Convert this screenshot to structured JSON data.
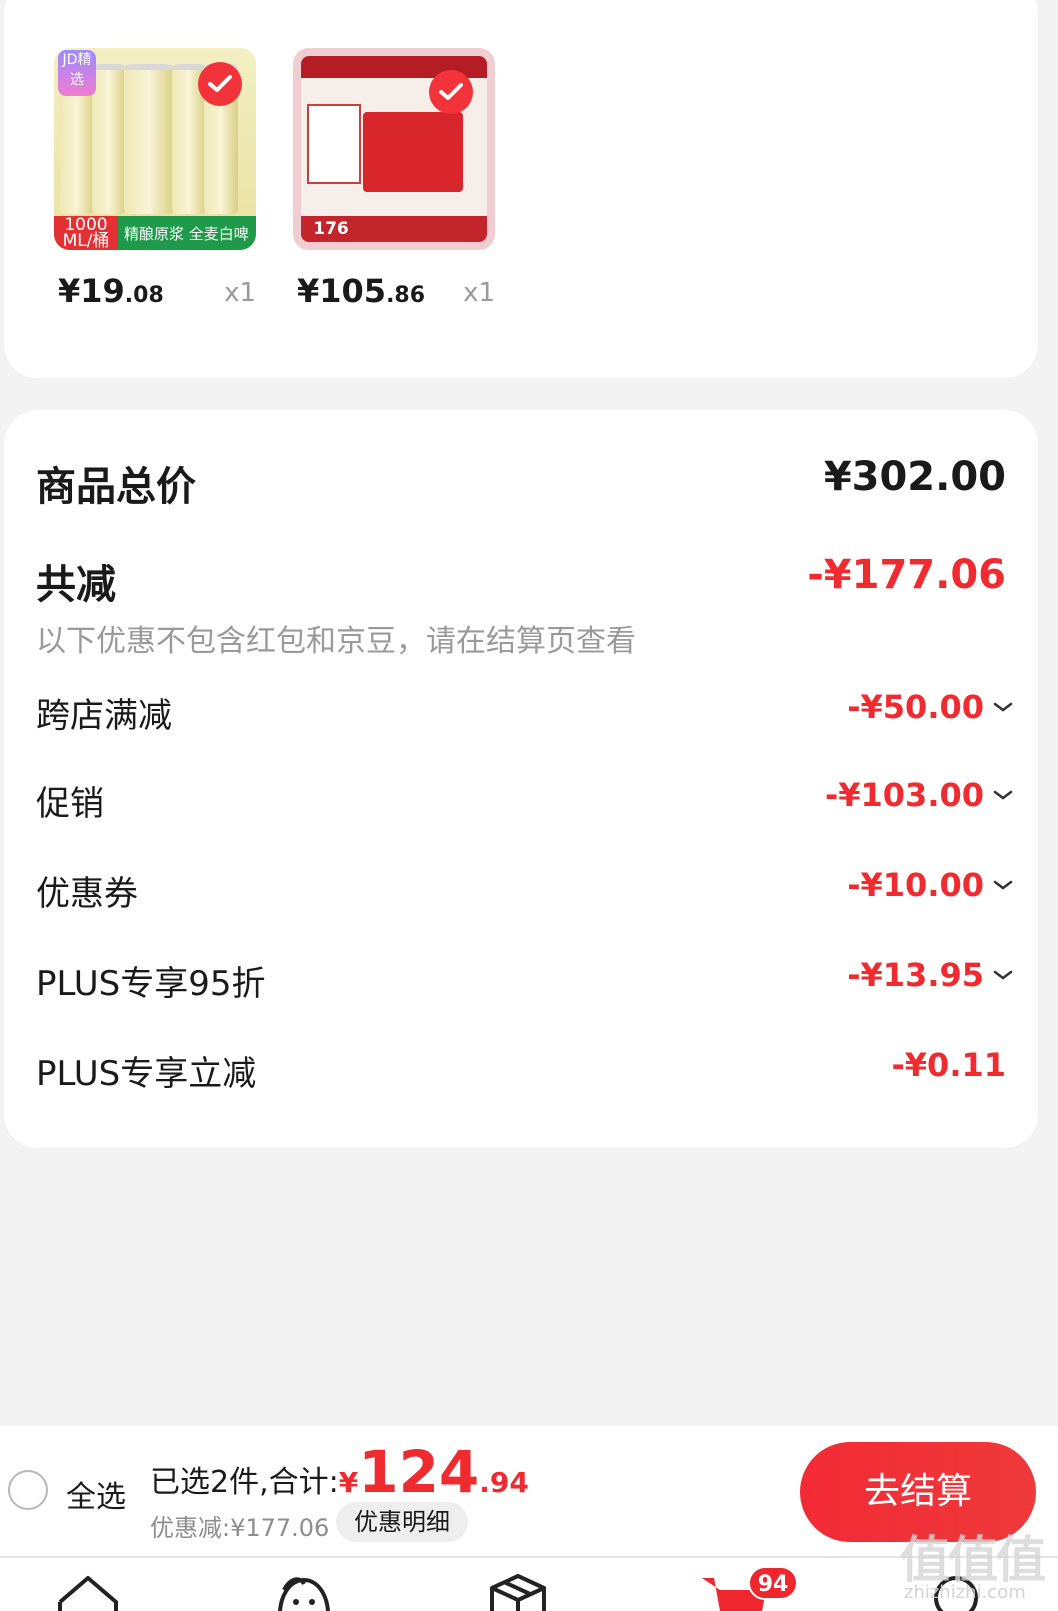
{
  "products": [
    {
      "image_label": "beer-product-image",
      "tag": "JD精选",
      "volume": "1000 ML/桶",
      "banner": "精酿原浆 全麦白啤",
      "price_int": "¥19",
      "price_dec": ".08",
      "qty": "x1"
    },
    {
      "image_label": "liquor-gift-box-image",
      "banner_price": "176",
      "price_int": "¥105",
      "price_dec": ".86",
      "qty": "x1"
    }
  ],
  "summary": {
    "total_label": "商品总价",
    "total_value": "¥302.00",
    "reduce_label": "共减",
    "reduce_value": "-¥177.06",
    "note": "以下优惠不包含红包和京豆，请在结算页查看",
    "items": [
      {
        "label": "跨店满减",
        "value": "-¥50.00",
        "expandable": true
      },
      {
        "label": "促销",
        "value": "-¥103.00",
        "expandable": true
      },
      {
        "label": "优惠券",
        "value": "-¥10.00",
        "expandable": true
      },
      {
        "label": "PLUS专享95折",
        "value": "-¥13.95",
        "expandable": true
      },
      {
        "label": "PLUS专享立减",
        "value": "-¥0.11",
        "expandable": false
      }
    ]
  },
  "bottom_bar": {
    "select_all": "全选",
    "selected_text": "已选2件,合计:",
    "sum_yen": "¥",
    "sum_int": "124",
    "sum_dec": ".94",
    "discount_text": "优惠减:¥177.06",
    "detail_button": "优惠明细",
    "checkout_button": "去结算"
  },
  "tab_bar": {
    "cart_badge": "94",
    "icons": [
      "home-icon",
      "face-icon",
      "box-icon",
      "cart-icon",
      "profile-icon"
    ]
  },
  "watermark": {
    "main": "值值值",
    "sub": "zhizhizhi.com"
  },
  "colors": {
    "accent_red": "#ef2b2f",
    "text_dark": "#1a1a1a",
    "text_muted": "#9a9a9a",
    "page_bg": "#f3f3f3"
  }
}
